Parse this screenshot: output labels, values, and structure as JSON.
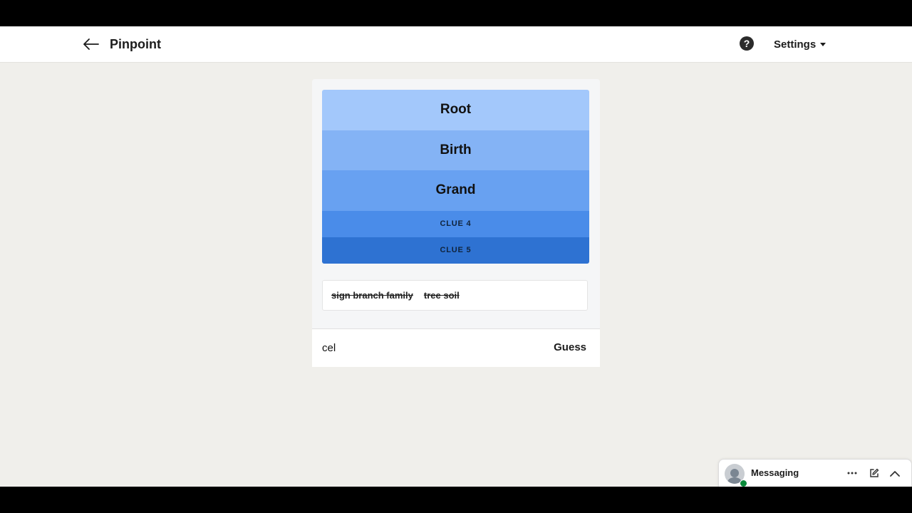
{
  "header": {
    "title": "Pinpoint",
    "settings_label": "Settings"
  },
  "clues": [
    {
      "label": "Root",
      "revealed": true
    },
    {
      "label": "Birth",
      "revealed": true
    },
    {
      "label": "Grand",
      "revealed": true
    },
    {
      "label": "CLUE 4",
      "revealed": false
    },
    {
      "label": "CLUE 5",
      "revealed": false
    }
  ],
  "wrong_guesses": [
    "sign branch family",
    "tree soil"
  ],
  "guess_form": {
    "input_value": "cel",
    "button_label": "Guess"
  },
  "messaging": {
    "label": "Messaging"
  },
  "colors": {
    "clue_1": "#a3c8fb",
    "clue_2": "#84b3f5",
    "clue_3": "#68a1f1",
    "clue_4": "#4a8ce9",
    "clue_5": "#2e72d2",
    "presence": "#0a8a3a"
  },
  "icons": {
    "back": "arrow-left-icon",
    "help": "question-circle-icon",
    "settings_caret": "caret-down-icon",
    "more": "ellipsis-icon",
    "compose": "compose-icon",
    "collapse": "chevron-up-icon"
  }
}
